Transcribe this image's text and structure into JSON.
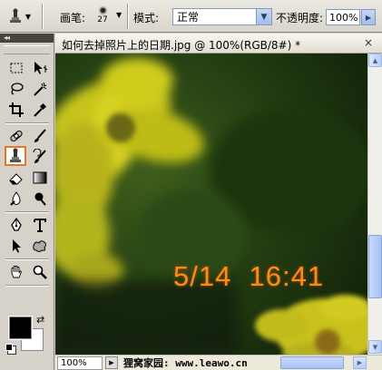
{
  "options_bar": {
    "brush_label": "画笔:",
    "brush_size": "27",
    "mode_label": "模式:",
    "mode_value": "正常",
    "opacity_label": "不透明度:",
    "opacity_value": "100%"
  },
  "toolbox": {
    "collapse_glyph": "◂◂",
    "foreground_color": "#000000",
    "background_color": "#ffffff",
    "active_tool": "clone-stamp"
  },
  "document": {
    "title": "如何去掉照片上的日期.jpg @ 100%(RGB/8#) *",
    "close_glyph": "×",
    "date_stamp": "5/14  16:41",
    "zoom": "100%",
    "status_text": "狸窝家园: www.leawo.cn"
  },
  "colors": {
    "accent_active": "#e8752a",
    "date_stamp": "#ff8a1a"
  }
}
